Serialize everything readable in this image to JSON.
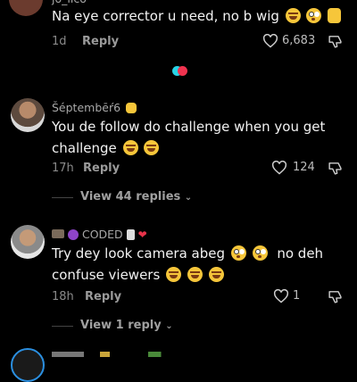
{
  "comments": [
    {
      "username": "jo_ilco",
      "text": "Na eye corrector u need, no b wig",
      "emojis": [
        "laugh",
        "wow",
        "paws"
      ],
      "time": "1d",
      "reply_label": "Reply",
      "likes": "6,683"
    },
    {
      "username": "Šéptembēŕ6",
      "text_line1": "You de follow do challenge when you get",
      "text_line2": "challenge",
      "emojis": [
        "laugh",
        "laugh"
      ],
      "time": "17h",
      "reply_label": "Reply",
      "likes": "124",
      "view_replies": "View 44 replies"
    },
    {
      "username": "CODED",
      "text_line1": "Try dey look camera abeg",
      "text_line1b": "no deh",
      "text_line2": "confuse viewers",
      "emojis_line1": [
        "wow",
        "wow"
      ],
      "emojis_line2": [
        "laugh",
        "laugh",
        "laugh"
      ],
      "time": "18h",
      "reply_label": "Reply",
      "likes": "1",
      "view_replies": "View 1 reply"
    }
  ],
  "colors": {
    "background": "#000000",
    "text": "#f2f2f2",
    "muted": "#8a8a8a",
    "divider": "#444444"
  }
}
